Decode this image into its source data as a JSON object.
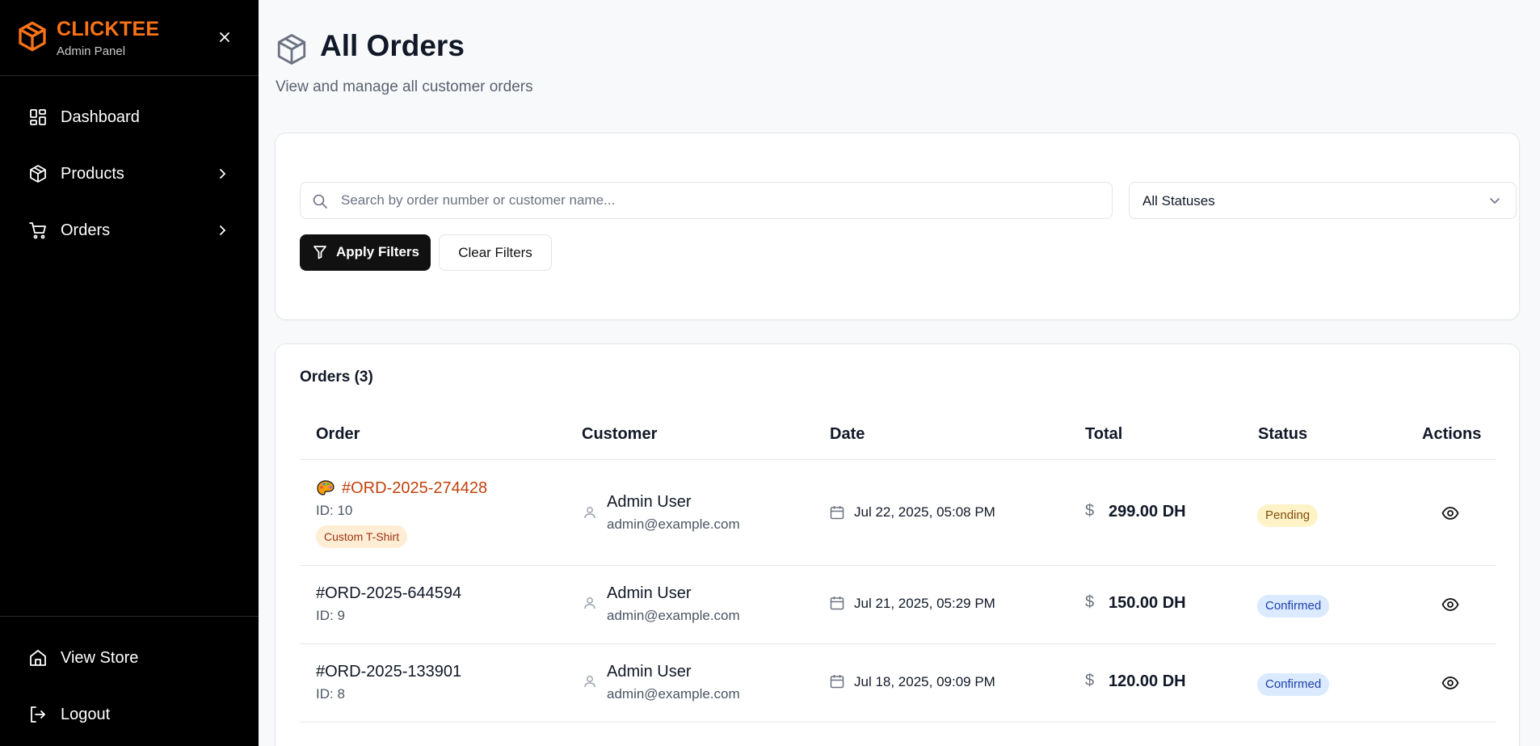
{
  "brand": {
    "name": "CLICKTEE",
    "subtitle": "Admin Panel",
    "color": "#f97316"
  },
  "sidebar": {
    "items": [
      {
        "label": "Dashboard",
        "icon": "dashboard-icon"
      },
      {
        "label": "Products",
        "icon": "box-icon",
        "has_chevron": true
      },
      {
        "label": "Orders",
        "icon": "cart-icon",
        "has_chevron": true
      }
    ],
    "bottom": [
      {
        "label": "View Store",
        "icon": "home-icon"
      },
      {
        "label": "Logout",
        "icon": "logout-icon"
      }
    ]
  },
  "header": {
    "title": "All Orders",
    "subtitle": "View and manage all customer orders"
  },
  "filters": {
    "search_placeholder": "Search by order number or customer name...",
    "search_value": "",
    "status_value": "All Statuses",
    "apply_label": "Apply Filters",
    "clear_label": "Clear Filters"
  },
  "orders": {
    "title": "Orders (3)",
    "columns": [
      "Order",
      "Customer",
      "Date",
      "Total",
      "Status",
      "Actions"
    ],
    "rows": [
      {
        "number": "#ORD-2025-274428",
        "id": "ID: 10",
        "tag": "Custom T-Shirt",
        "custom": true,
        "customer": "Admin User",
        "email": "admin@example.com",
        "date": "Jul 22, 2025, 05:08 PM",
        "currency_symbol": "$",
        "total": "299.00 DH",
        "status": "Pending"
      },
      {
        "number": "#ORD-2025-644594",
        "id": "ID: 9",
        "customer": "Admin User",
        "email": "admin@example.com",
        "date": "Jul 21, 2025, 05:29 PM",
        "currency_symbol": "$",
        "total": "150.00 DH",
        "status": "Confirmed"
      },
      {
        "number": "#ORD-2025-133901",
        "id": "ID: 8",
        "customer": "Admin User",
        "email": "admin@example.com",
        "date": "Jul 18, 2025, 09:09 PM",
        "currency_symbol": "$",
        "total": "120.00 DH",
        "status": "Confirmed"
      }
    ]
  },
  "colors": {
    "pending_bg": "#fef3c7",
    "confirmed_bg": "#dbeafe",
    "custom_order": "#c2410c"
  }
}
